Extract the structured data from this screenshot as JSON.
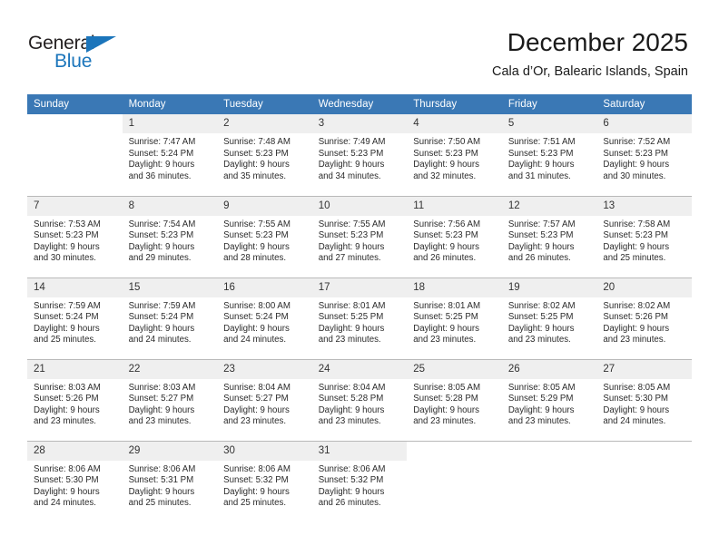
{
  "brand": {
    "name_part1": "General",
    "name_part2": "Blue",
    "triangle_icon": "triangle-icon",
    "color_dark": "#231f20",
    "color_blue": "#1b75bb"
  },
  "header": {
    "month_title": "December 2025",
    "location": "Cala d’Or, Balearic Islands, Spain"
  },
  "theme": {
    "header_row_bg": "#3a78b5",
    "header_row_text": "#ffffff",
    "daynum_bg": "#efefef",
    "cell_bg": "#ffffff",
    "row_divider": "#b9b9b9",
    "body_text": "#2b2b2b"
  },
  "weekday_headers": [
    "Sunday",
    "Monday",
    "Tuesday",
    "Wednesday",
    "Thursday",
    "Friday",
    "Saturday"
  ],
  "weeks": [
    [
      {
        "day": "",
        "blank": true,
        "sunrise": "",
        "sunset": "",
        "daylight_line1": "",
        "daylight_line2": ""
      },
      {
        "day": "1",
        "blank": false,
        "sunrise": "Sunrise: 7:47 AM",
        "sunset": "Sunset: 5:24 PM",
        "daylight_line1": "Daylight: 9 hours",
        "daylight_line2": "and 36 minutes."
      },
      {
        "day": "2",
        "blank": false,
        "sunrise": "Sunrise: 7:48 AM",
        "sunset": "Sunset: 5:23 PM",
        "daylight_line1": "Daylight: 9 hours",
        "daylight_line2": "and 35 minutes."
      },
      {
        "day": "3",
        "blank": false,
        "sunrise": "Sunrise: 7:49 AM",
        "sunset": "Sunset: 5:23 PM",
        "daylight_line1": "Daylight: 9 hours",
        "daylight_line2": "and 34 minutes."
      },
      {
        "day": "4",
        "blank": false,
        "sunrise": "Sunrise: 7:50 AM",
        "sunset": "Sunset: 5:23 PM",
        "daylight_line1": "Daylight: 9 hours",
        "daylight_line2": "and 32 minutes."
      },
      {
        "day": "5",
        "blank": false,
        "sunrise": "Sunrise: 7:51 AM",
        "sunset": "Sunset: 5:23 PM",
        "daylight_line1": "Daylight: 9 hours",
        "daylight_line2": "and 31 minutes."
      },
      {
        "day": "6",
        "blank": false,
        "sunrise": "Sunrise: 7:52 AM",
        "sunset": "Sunset: 5:23 PM",
        "daylight_line1": "Daylight: 9 hours",
        "daylight_line2": "and 30 minutes."
      }
    ],
    [
      {
        "day": "7",
        "blank": false,
        "sunrise": "Sunrise: 7:53 AM",
        "sunset": "Sunset: 5:23 PM",
        "daylight_line1": "Daylight: 9 hours",
        "daylight_line2": "and 30 minutes."
      },
      {
        "day": "8",
        "blank": false,
        "sunrise": "Sunrise: 7:54 AM",
        "sunset": "Sunset: 5:23 PM",
        "daylight_line1": "Daylight: 9 hours",
        "daylight_line2": "and 29 minutes."
      },
      {
        "day": "9",
        "blank": false,
        "sunrise": "Sunrise: 7:55 AM",
        "sunset": "Sunset: 5:23 PM",
        "daylight_line1": "Daylight: 9 hours",
        "daylight_line2": "and 28 minutes."
      },
      {
        "day": "10",
        "blank": false,
        "sunrise": "Sunrise: 7:55 AM",
        "sunset": "Sunset: 5:23 PM",
        "daylight_line1": "Daylight: 9 hours",
        "daylight_line2": "and 27 minutes."
      },
      {
        "day": "11",
        "blank": false,
        "sunrise": "Sunrise: 7:56 AM",
        "sunset": "Sunset: 5:23 PM",
        "daylight_line1": "Daylight: 9 hours",
        "daylight_line2": "and 26 minutes."
      },
      {
        "day": "12",
        "blank": false,
        "sunrise": "Sunrise: 7:57 AM",
        "sunset": "Sunset: 5:23 PM",
        "daylight_line1": "Daylight: 9 hours",
        "daylight_line2": "and 26 minutes."
      },
      {
        "day": "13",
        "blank": false,
        "sunrise": "Sunrise: 7:58 AM",
        "sunset": "Sunset: 5:23 PM",
        "daylight_line1": "Daylight: 9 hours",
        "daylight_line2": "and 25 minutes."
      }
    ],
    [
      {
        "day": "14",
        "blank": false,
        "sunrise": "Sunrise: 7:59 AM",
        "sunset": "Sunset: 5:24 PM",
        "daylight_line1": "Daylight: 9 hours",
        "daylight_line2": "and 25 minutes."
      },
      {
        "day": "15",
        "blank": false,
        "sunrise": "Sunrise: 7:59 AM",
        "sunset": "Sunset: 5:24 PM",
        "daylight_line1": "Daylight: 9 hours",
        "daylight_line2": "and 24 minutes."
      },
      {
        "day": "16",
        "blank": false,
        "sunrise": "Sunrise: 8:00 AM",
        "sunset": "Sunset: 5:24 PM",
        "daylight_line1": "Daylight: 9 hours",
        "daylight_line2": "and 24 minutes."
      },
      {
        "day": "17",
        "blank": false,
        "sunrise": "Sunrise: 8:01 AM",
        "sunset": "Sunset: 5:25 PM",
        "daylight_line1": "Daylight: 9 hours",
        "daylight_line2": "and 23 minutes."
      },
      {
        "day": "18",
        "blank": false,
        "sunrise": "Sunrise: 8:01 AM",
        "sunset": "Sunset: 5:25 PM",
        "daylight_line1": "Daylight: 9 hours",
        "daylight_line2": "and 23 minutes."
      },
      {
        "day": "19",
        "blank": false,
        "sunrise": "Sunrise: 8:02 AM",
        "sunset": "Sunset: 5:25 PM",
        "daylight_line1": "Daylight: 9 hours",
        "daylight_line2": "and 23 minutes."
      },
      {
        "day": "20",
        "blank": false,
        "sunrise": "Sunrise: 8:02 AM",
        "sunset": "Sunset: 5:26 PM",
        "daylight_line1": "Daylight: 9 hours",
        "daylight_line2": "and 23 minutes."
      }
    ],
    [
      {
        "day": "21",
        "blank": false,
        "sunrise": "Sunrise: 8:03 AM",
        "sunset": "Sunset: 5:26 PM",
        "daylight_line1": "Daylight: 9 hours",
        "daylight_line2": "and 23 minutes."
      },
      {
        "day": "22",
        "blank": false,
        "sunrise": "Sunrise: 8:03 AM",
        "sunset": "Sunset: 5:27 PM",
        "daylight_line1": "Daylight: 9 hours",
        "daylight_line2": "and 23 minutes."
      },
      {
        "day": "23",
        "blank": false,
        "sunrise": "Sunrise: 8:04 AM",
        "sunset": "Sunset: 5:27 PM",
        "daylight_line1": "Daylight: 9 hours",
        "daylight_line2": "and 23 minutes."
      },
      {
        "day": "24",
        "blank": false,
        "sunrise": "Sunrise: 8:04 AM",
        "sunset": "Sunset: 5:28 PM",
        "daylight_line1": "Daylight: 9 hours",
        "daylight_line2": "and 23 minutes."
      },
      {
        "day": "25",
        "blank": false,
        "sunrise": "Sunrise: 8:05 AM",
        "sunset": "Sunset: 5:28 PM",
        "daylight_line1": "Daylight: 9 hours",
        "daylight_line2": "and 23 minutes."
      },
      {
        "day": "26",
        "blank": false,
        "sunrise": "Sunrise: 8:05 AM",
        "sunset": "Sunset: 5:29 PM",
        "daylight_line1": "Daylight: 9 hours",
        "daylight_line2": "and 23 minutes."
      },
      {
        "day": "27",
        "blank": false,
        "sunrise": "Sunrise: 8:05 AM",
        "sunset": "Sunset: 5:30 PM",
        "daylight_line1": "Daylight: 9 hours",
        "daylight_line2": "and 24 minutes."
      }
    ],
    [
      {
        "day": "28",
        "blank": false,
        "sunrise": "Sunrise: 8:06 AM",
        "sunset": "Sunset: 5:30 PM",
        "daylight_line1": "Daylight: 9 hours",
        "daylight_line2": "and 24 minutes."
      },
      {
        "day": "29",
        "blank": false,
        "sunrise": "Sunrise: 8:06 AM",
        "sunset": "Sunset: 5:31 PM",
        "daylight_line1": "Daylight: 9 hours",
        "daylight_line2": "and 25 minutes."
      },
      {
        "day": "30",
        "blank": false,
        "sunrise": "Sunrise: 8:06 AM",
        "sunset": "Sunset: 5:32 PM",
        "daylight_line1": "Daylight: 9 hours",
        "daylight_line2": "and 25 minutes."
      },
      {
        "day": "31",
        "blank": false,
        "sunrise": "Sunrise: 8:06 AM",
        "sunset": "Sunset: 5:32 PM",
        "daylight_line1": "Daylight: 9 hours",
        "daylight_line2": "and 26 minutes."
      },
      {
        "day": "",
        "blank": true,
        "sunrise": "",
        "sunset": "",
        "daylight_line1": "",
        "daylight_line2": ""
      },
      {
        "day": "",
        "blank": true,
        "sunrise": "",
        "sunset": "",
        "daylight_line1": "",
        "daylight_line2": ""
      },
      {
        "day": "",
        "blank": true,
        "sunrise": "",
        "sunset": "",
        "daylight_line1": "",
        "daylight_line2": ""
      }
    ]
  ]
}
